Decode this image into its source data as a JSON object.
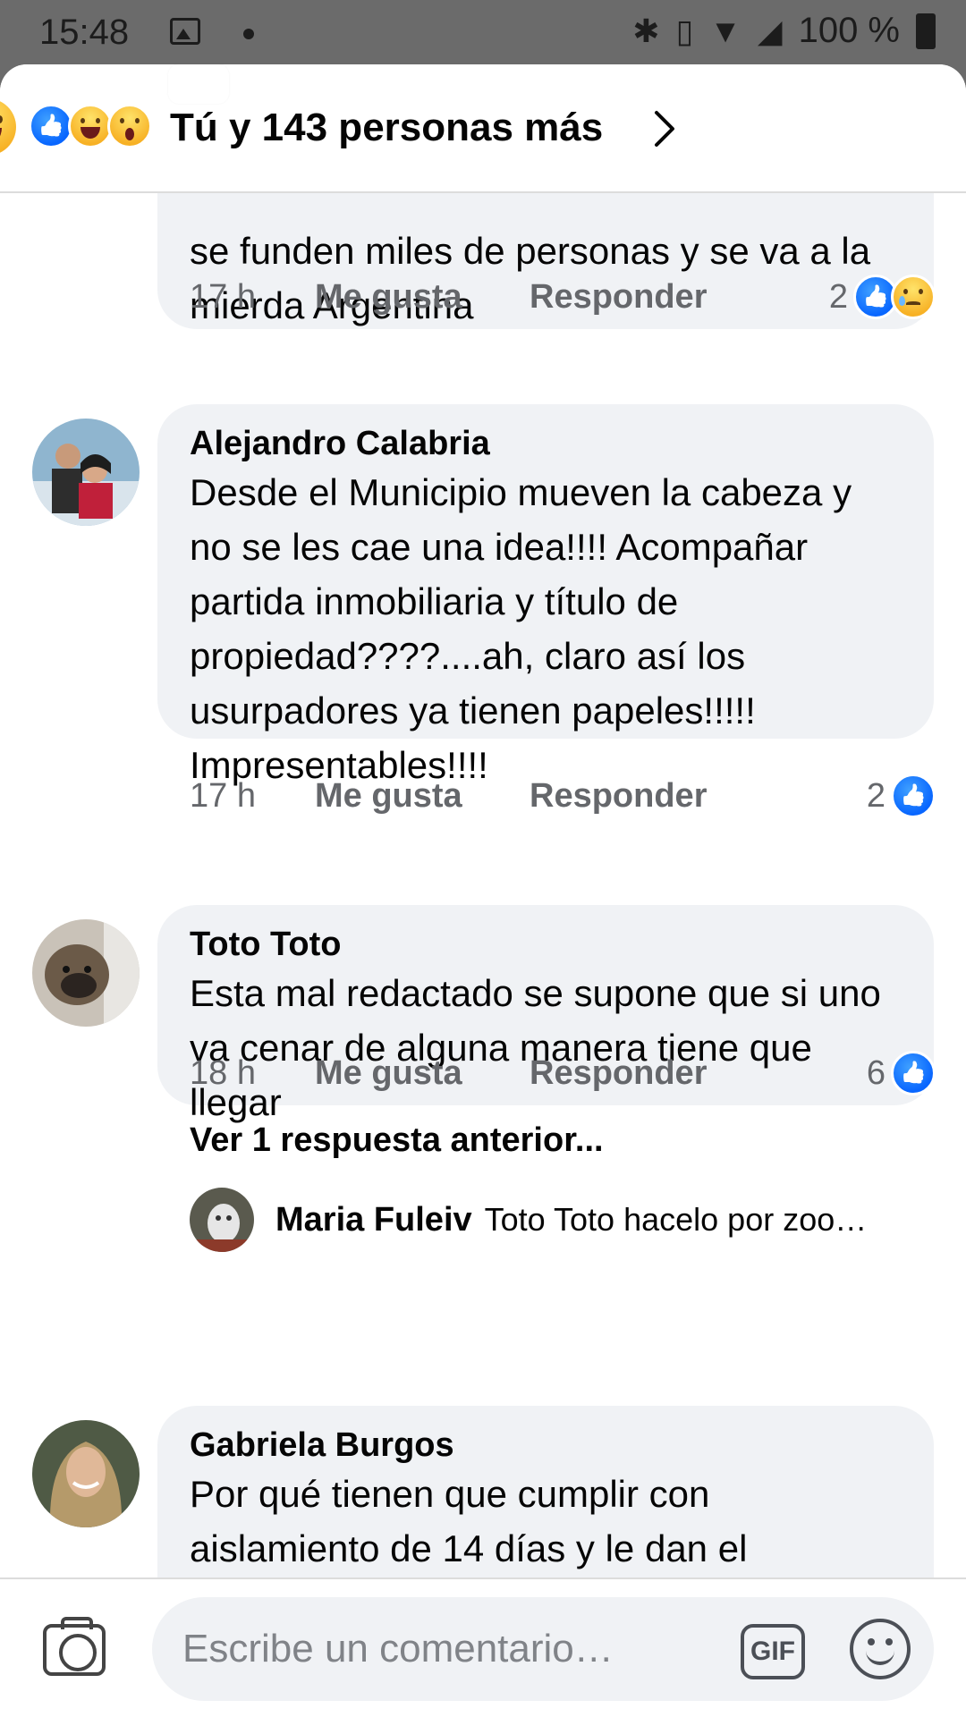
{
  "status_bar": {
    "time": "15:48",
    "battery": "100 %"
  },
  "reactions_header": {
    "summary": "Tú y 143 personas más",
    "icons": [
      "like-icon",
      "haha-icon",
      "wow-icon"
    ],
    "selected_reaction": "haha-icon"
  },
  "comments": [
    {
      "author": "",
      "text": "se funden miles de personas y se va a la mierda Argentina",
      "time": "17 h",
      "like_label": "Me gusta",
      "reply_label": "Responder",
      "reaction_count": "2",
      "reaction_icons": [
        "like-icon",
        "sad-icon"
      ]
    },
    {
      "author": "Alejandro Calabria",
      "text": "Desde el Municipio mueven la cabeza y no se les cae una idea!!!! Acompañar partida inmobiliaria y título de propiedad????....ah, claro así los usurpadores ya tienen papeles!!!!! Impresentables!!!!",
      "time": "17 h",
      "like_label": "Me gusta",
      "reply_label": "Responder",
      "reaction_count": "2",
      "reaction_icons": [
        "like-icon"
      ]
    },
    {
      "author": "Toto Toto",
      "text": "Esta mal redactado se supone que si uno va cenar de alguna manera tiene que llegar",
      "time": "18 h",
      "like_label": "Me gusta",
      "reply_label": "Responder",
      "reaction_count": "6",
      "reaction_icons": [
        "like-icon"
      ],
      "see_replies": "Ver 1 respuesta anterior...",
      "reply_preview": {
        "author": "Maria Fuleiv",
        "text": "Toto Toto  hacelo por zoo…"
      }
    },
    {
      "author": "Gabriela Burgos",
      "text": "Por qué tienen que cumplir con aislamiento de 14 días y le dan el"
    }
  ],
  "composer": {
    "placeholder": "Escribe un comentario…",
    "gif_label": "GIF"
  },
  "colors": {
    "like_blue": "#0866ff",
    "bubble_bg": "#f0f2f5",
    "meta_gray": "#65676b"
  }
}
